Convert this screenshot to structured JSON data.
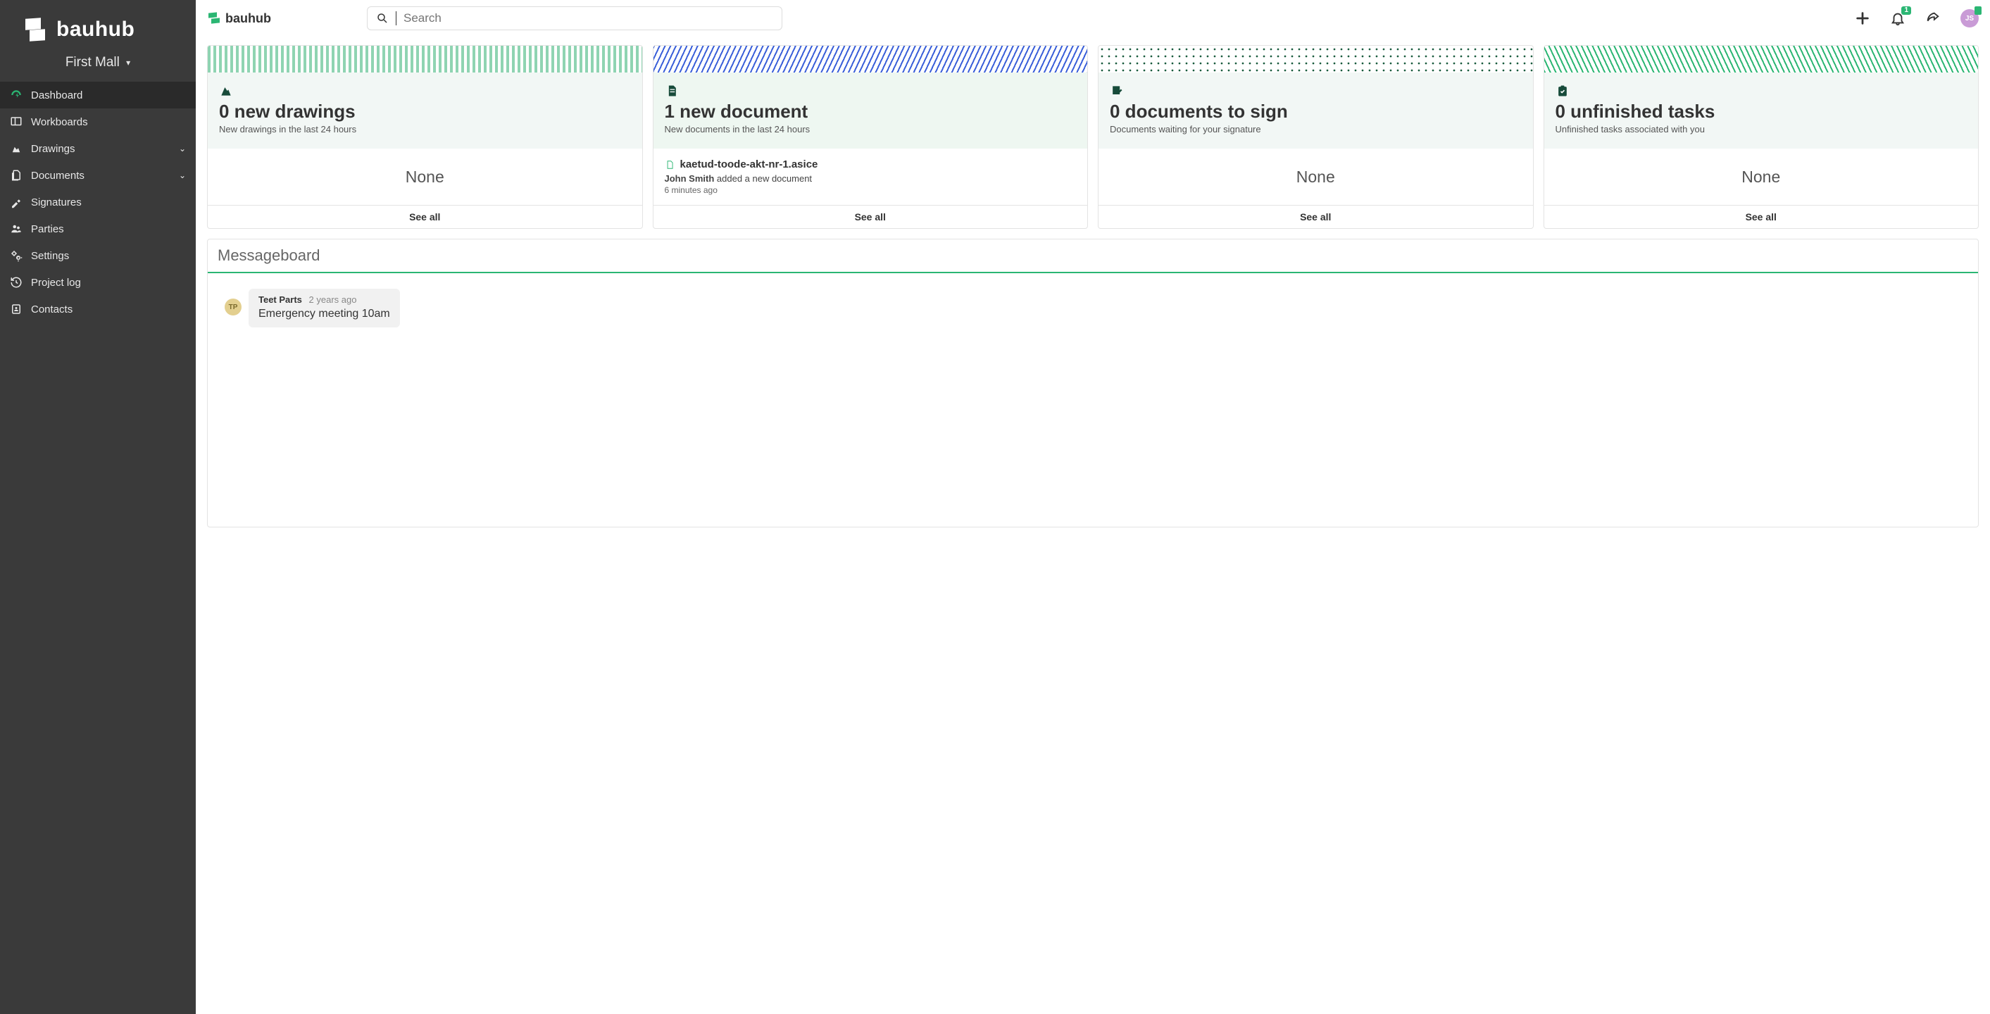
{
  "brand": "bauhub",
  "project_name": "First Mall",
  "search": {
    "placeholder": "Search"
  },
  "notifications": {
    "count": "1"
  },
  "user": {
    "initials": "JS"
  },
  "sidebar": {
    "items": [
      {
        "label": "Dashboard"
      },
      {
        "label": "Workboards"
      },
      {
        "label": "Drawings"
      },
      {
        "label": "Documents"
      },
      {
        "label": "Signatures"
      },
      {
        "label": "Parties"
      },
      {
        "label": "Settings"
      },
      {
        "label": "Project log"
      },
      {
        "label": "Contacts"
      }
    ]
  },
  "cards": {
    "see_all_label": "See all",
    "none_label": "None",
    "drawings": {
      "title": "0 new drawings",
      "subtitle": "New drawings in the last 24 hours"
    },
    "documents": {
      "title": "1 new document",
      "subtitle": "New documents in the last 24 hours",
      "item": {
        "filename": "kaetud-toode-akt-nr-1.asice",
        "actor": "John Smith",
        "action": " added a new document",
        "time": "6 minutes ago"
      }
    },
    "tosign": {
      "title": "0 documents to sign",
      "subtitle": "Documents waiting for your signature"
    },
    "tasks": {
      "title": "0 unfinished tasks",
      "subtitle": "Unfinished tasks associated with you"
    }
  },
  "messageboard": {
    "title": "Messageboard",
    "messages": [
      {
        "initials": "TP",
        "author": "Teet Parts",
        "time": "2 years ago",
        "text": "Emergency meeting 10am"
      }
    ]
  }
}
